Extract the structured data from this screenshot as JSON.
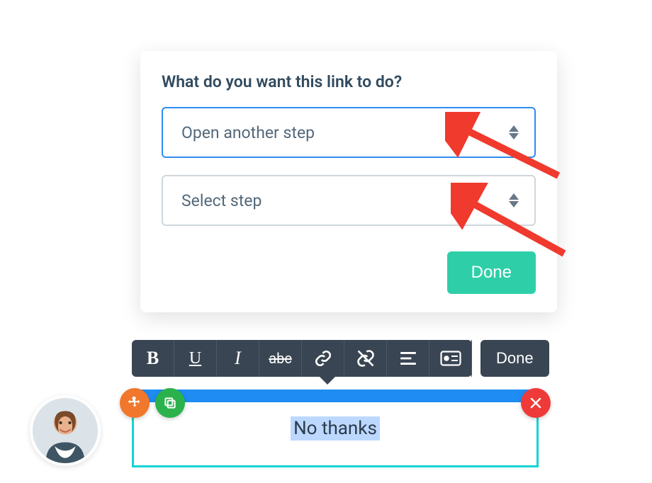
{
  "dialog": {
    "title": "What do you want this link to do?",
    "action_select": "Open another step",
    "step_select_placeholder": "Select step",
    "done_label": "Done"
  },
  "toolbar": {
    "done_label": "Done"
  },
  "editor": {
    "selected_text": "No thanks"
  },
  "icons": {
    "bold": "bold-icon",
    "underline": "underline-icon",
    "italic": "italic-icon",
    "strike": "strikethrough-icon",
    "link": "link-icon",
    "unlink": "unlink-icon",
    "align": "align-icon",
    "card": "card-icon",
    "move": "move-icon",
    "copy": "copy-icon",
    "close": "close-icon"
  },
  "colors": {
    "accent_blue": "#2e8cf0",
    "accent_teal": "#15d4d4",
    "accent_green": "#2ecfa8",
    "annotation_red": "#f03a2d",
    "toolbar_bg": "#394552"
  }
}
